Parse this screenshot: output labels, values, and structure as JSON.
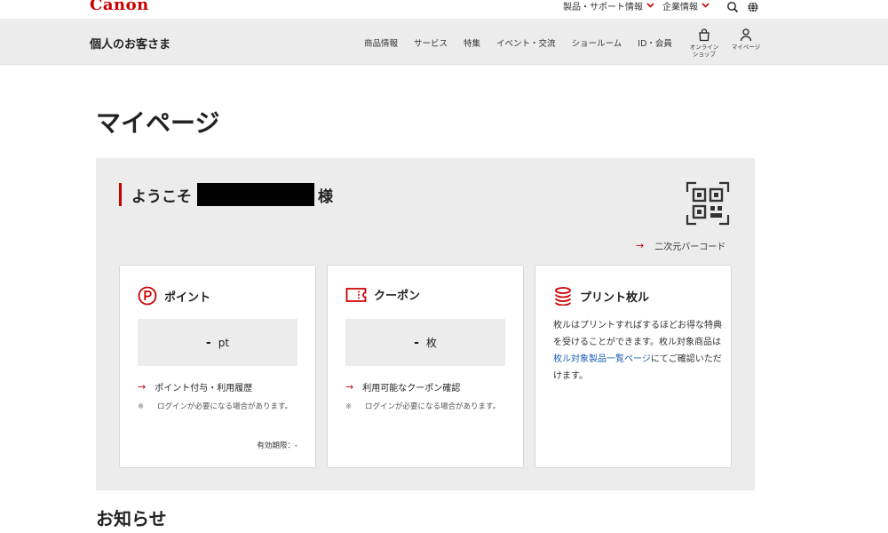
{
  "header": {
    "logo": "Canon",
    "top_links": [
      {
        "label": "製品・サポート情報"
      },
      {
        "label": "企業情報"
      }
    ],
    "icons": [
      "search-icon",
      "globe-icon"
    ]
  },
  "nav": {
    "title": "個人のお客さま",
    "menu": [
      "商品情報",
      "サービス",
      "特集",
      "イベント・交流",
      "ショールーム",
      "ID・会員"
    ],
    "shop": {
      "line1": "オンライン",
      "line2": "ショップ"
    },
    "mypage": {
      "label": "マイページ"
    }
  },
  "page": {
    "title": "マイページ"
  },
  "member": {
    "welcome_prefix": "ようこそ",
    "welcome_suffix": "様",
    "qr_link": "二次元バーコード"
  },
  "cards": {
    "points": {
      "title": "ポイント",
      "value": "-",
      "unit": "pt",
      "link": "ポイント付与・利用履歴",
      "note_mark": "※",
      "note": "ログインが必要になる場合があります。",
      "expiry": "有効期限：-"
    },
    "coupons": {
      "title": "クーポン",
      "value": "-",
      "unit": "枚",
      "link": "利用可能なクーポン確認",
      "note_mark": "※",
      "note": "ログインが必要になる場合があります。"
    },
    "print": {
      "title": "プリント枚ル",
      "text_before": "枚ルはプリントすればするほどお得な特典を受けることができます。枚ル対象商品は",
      "text_link": "枚ル対象製品一覧ページ",
      "text_after": "にてご確認いただけます。"
    }
  },
  "news": {
    "title": "お知らせ"
  },
  "colors": {
    "brand": "#cc0000",
    "panel_bg": "#ececec",
    "link": "#1a5fb4"
  }
}
